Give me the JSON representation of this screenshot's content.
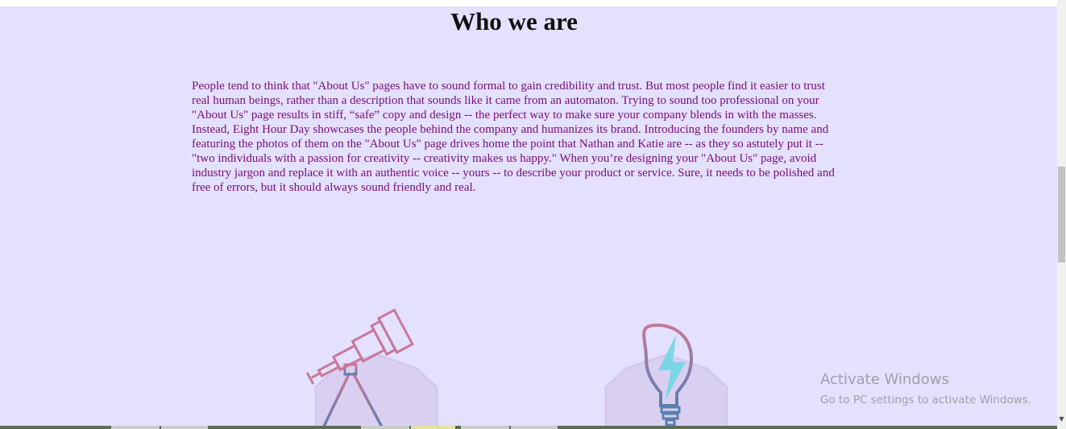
{
  "section": {
    "title": "Who we are",
    "body": "People tend to think that \"About Us\" pages have to sound formal to gain credibility and trust. But most people find it easier to trust real human beings, rather than a description that sounds like it came from an automaton. Trying to sound too professional on your \"About Us\" page results in stiff, “safe” copy and design -- the perfect way to make sure your company blends in with the masses. Instead, Eight Hour Day showcases the people behind the company and humanizes its brand. Introducing the founders by name and featuring the photos of them on the \"About Us\" page drives home the point that Nathan and Katie are -- as they so astutely put it -- \"two individuals with a passion for creativity -- creativity makes us happy.\" When you’re designing your \"About Us\" page, avoid industry jargon and replace it with an authentic voice -- yours -- to describe your product or service. Sure, it needs to be polished and free of errors, but it should always sound friendly and real."
  },
  "illustrations": {
    "left_icon": "telescope-icon",
    "right_icon": "lightbulb-icon"
  },
  "watermark": {
    "title": "Activate Windows",
    "subtitle": "Go to PC settings to activate Windows."
  },
  "scrollbar": {
    "down_arrow": "▼"
  },
  "colors": {
    "page_background": "#e3e1fe",
    "body_text": "#7a0c7a",
    "heading_text": "#111111",
    "icon_gradient_start": "#c8789a",
    "icon_gradient_end": "#5b7fb0",
    "bolt_color": "#6fd6e0"
  }
}
